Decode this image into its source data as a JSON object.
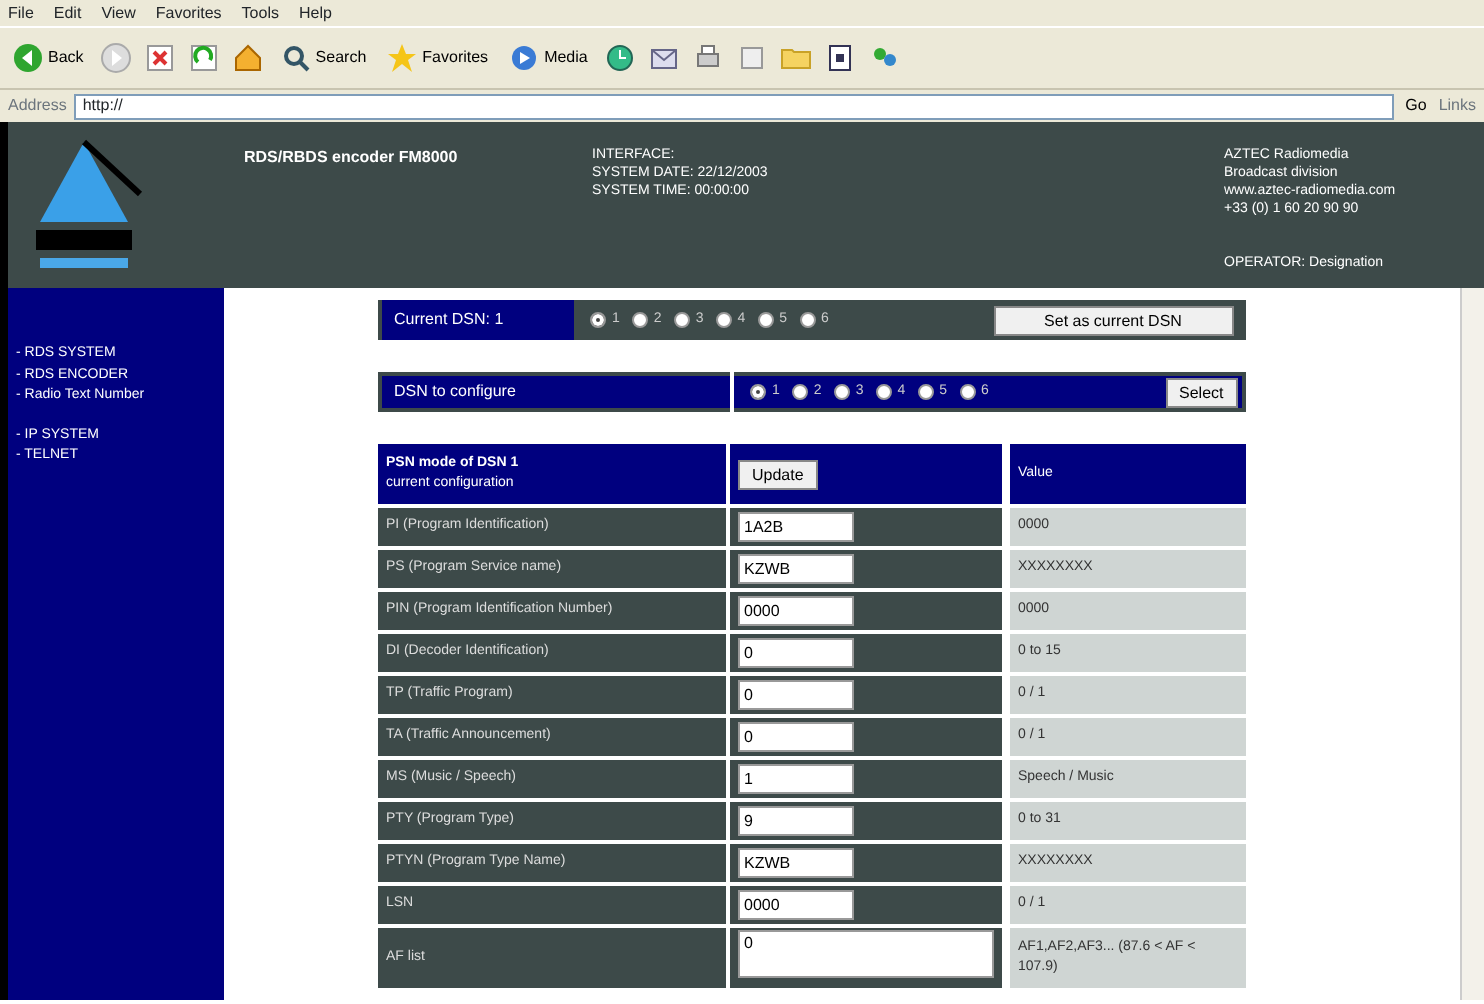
{
  "browser": {
    "menu": [
      "File",
      "Edit",
      "View",
      "Favorites",
      "Tools",
      "Help"
    ],
    "toolbar": [
      {
        "kind": "back",
        "label": "Back"
      },
      {
        "kind": "forward"
      },
      {
        "kind": "stop"
      },
      {
        "kind": "refresh"
      },
      {
        "kind": "home"
      },
      {
        "kind": "search",
        "label": "Search"
      },
      {
        "kind": "favorites",
        "label": "Favorites"
      },
      {
        "kind": "media",
        "label": "Media"
      },
      {
        "kind": "history"
      },
      {
        "kind": "mail"
      },
      {
        "kind": "print"
      },
      {
        "kind": "edit"
      },
      {
        "kind": "folder"
      },
      {
        "kind": "window"
      },
      {
        "kind": "messenger"
      }
    ],
    "address_label": "Address",
    "address": "http://",
    "go": "Go",
    "links": "Links"
  },
  "header": {
    "title": "RDS/RBDS encoder FM8000",
    "info": [
      "INTERFACE:",
      "SYSTEM DATE: 22/12/2003",
      "SYSTEM TIME: 00:00:00"
    ],
    "company": [
      "AZTEC Radiomedia",
      "Broadcast division",
      "www.aztec-radiomedia.com",
      "+33 (0) 1 60 20 90 90"
    ],
    "operator": "OPERATOR: Designation"
  },
  "sidebar": {
    "groups": [
      [
        "- RDS SYSTEM",
        "- RDS ENCODER",
        "- Radio Text Number"
      ],
      [
        "- IP SYSTEM",
        "- TELNET"
      ]
    ]
  },
  "current_dsn": {
    "label": "Current DSN: 1",
    "options": [
      {
        "label": "1",
        "selected": true
      },
      {
        "label": "2",
        "selected": false
      },
      {
        "label": "3",
        "selected": false
      },
      {
        "label": "4",
        "selected": false
      },
      {
        "label": "5",
        "selected": false
      },
      {
        "label": "6",
        "selected": false
      }
    ],
    "button": "Set as current DSN"
  },
  "configure": {
    "label": "DSN to configure",
    "options": [
      {
        "label": "1",
        "selected": true
      },
      {
        "label": "2",
        "selected": false
      },
      {
        "label": "3",
        "selected": false
      },
      {
        "label": "4",
        "selected": false
      },
      {
        "label": "5",
        "selected": false
      },
      {
        "label": "6",
        "selected": false
      }
    ],
    "button": "Select"
  },
  "table": {
    "title": "PSN mode of DSN 1",
    "subtitle": "current configuration",
    "button": "Update",
    "value_header": "Value",
    "rows": [
      {
        "label": "PI (Program Identification)",
        "value": "1A2B",
        "range": "0000",
        "kind": "input"
      },
      {
        "label": "PS (Program Service name)",
        "value": "KZWB",
        "range": "XXXXXXXX",
        "kind": "input"
      },
      {
        "label": "PIN (Program Identification Number)",
        "value": "0000",
        "range": "0000",
        "kind": "input"
      },
      {
        "label": "DI (Decoder Identification)",
        "value": "0",
        "range": "0 to 15",
        "kind": "input"
      },
      {
        "label": "TP (Traffic Program)",
        "value": "0",
        "range": "0 / 1",
        "kind": "input"
      },
      {
        "label": "TA (Traffic Announcement)",
        "value": "0",
        "range": "0 / 1",
        "kind": "input"
      },
      {
        "label": "MS (Music / Speech)",
        "value": "1",
        "range": "Speech / Music",
        "kind": "input"
      },
      {
        "label": "PTY (Program Type)",
        "value": "9",
        "range": "0 to 31",
        "kind": "input"
      },
      {
        "label": "PTYN (Program Type Name)",
        "value": "KZWB",
        "range": "XXXXXXXX",
        "kind": "input"
      },
      {
        "label": "LSN",
        "value": "0000",
        "range": "0 / 1",
        "kind": "input"
      },
      {
        "label": "AF list",
        "value": "0",
        "range": "AF1,AF2,AF3... (87.6 < AF < 107.9)",
        "kind": "textarea"
      }
    ]
  }
}
